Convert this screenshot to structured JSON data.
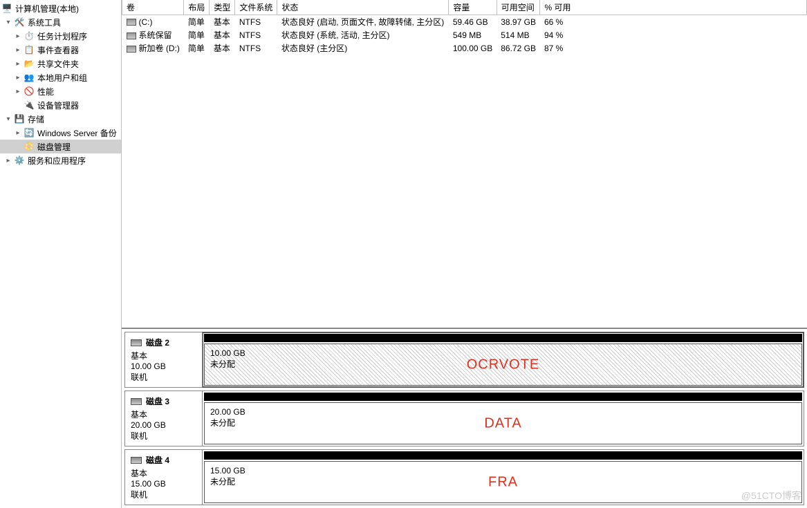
{
  "tree": {
    "root": "计算机管理(本地)",
    "system_tools": "系统工具",
    "task_scheduler": "任务计划程序",
    "event_viewer": "事件查看器",
    "shared_folders": "共享文件夹",
    "local_users": "本地用户和组",
    "performance": "性能",
    "device_manager": "设备管理器",
    "storage": "存储",
    "wsb": "Windows Server 备份",
    "disk_mgmt": "磁盘管理",
    "services": "服务和应用程序"
  },
  "cols": {
    "volume": "卷",
    "layout": "布局",
    "type": "类型",
    "fs": "文件系统",
    "status": "状态",
    "capacity": "容量",
    "free": "可用空间",
    "pct": "% 可用"
  },
  "volumes": [
    {
      "name": "(C:)",
      "layout": "简单",
      "type": "基本",
      "fs": "NTFS",
      "status": "状态良好 (启动, 页面文件, 故障转储, 主分区)",
      "capacity": "59.46 GB",
      "free": "38.97 GB",
      "pct": "66 %"
    },
    {
      "name": "系统保留",
      "layout": "简单",
      "type": "基本",
      "fs": "NTFS",
      "status": "状态良好 (系统, 活动, 主分区)",
      "capacity": "549 MB",
      "free": "514 MB",
      "pct": "94 %"
    },
    {
      "name": "新加卷 (D:)",
      "layout": "简单",
      "type": "基本",
      "fs": "NTFS",
      "status": "状态良好 (主分区)",
      "capacity": "100.00 GB",
      "free": "86.72 GB",
      "pct": "87 %"
    }
  ],
  "disks": [
    {
      "title": "磁盘 2",
      "type": "基本",
      "size": "10.00 GB",
      "state": "联机",
      "part_size": "10.00 GB",
      "part_state": "未分配",
      "annotation": "OCRVOTE",
      "hatch": true,
      "selected": true
    },
    {
      "title": "磁盘 3",
      "type": "基本",
      "size": "20.00 GB",
      "state": "联机",
      "part_size": "20.00 GB",
      "part_state": "未分配",
      "annotation": "DATA",
      "hatch": false,
      "selected": false
    },
    {
      "title": "磁盘 4",
      "type": "基本",
      "size": "15.00 GB",
      "state": "联机",
      "part_size": "15.00 GB",
      "part_state": "未分配",
      "annotation": "FRA",
      "hatch": false,
      "selected": false
    }
  ],
  "watermark": "@51CTO博客"
}
